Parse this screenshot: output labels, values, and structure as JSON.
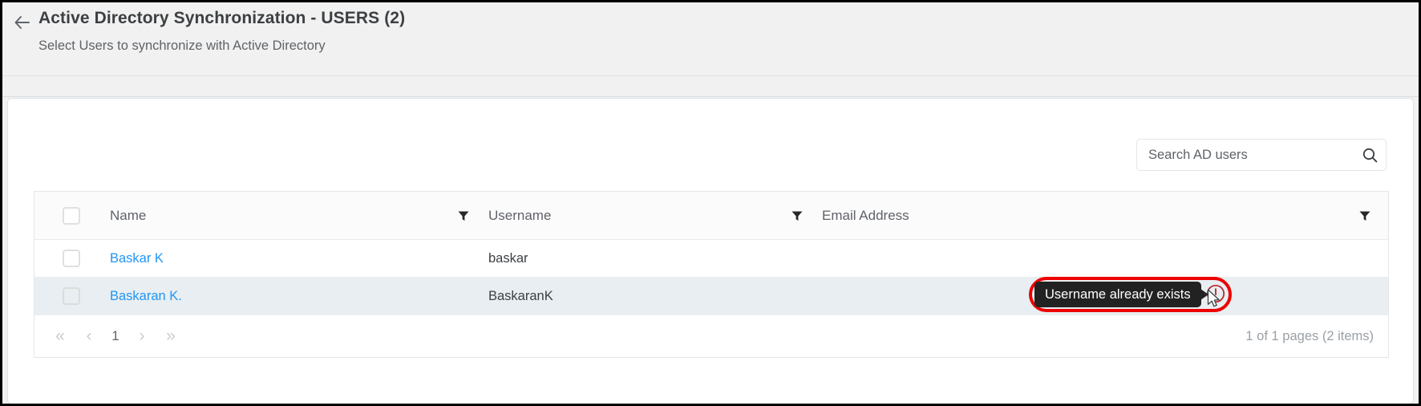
{
  "header": {
    "back_icon": "back-arrow-icon",
    "title": "Active Directory Synchronization - USERS (2)",
    "subtitle": "Select Users to synchronize with Active Directory"
  },
  "search": {
    "placeholder": "Search AD users",
    "value": "",
    "icon": "search-icon"
  },
  "table": {
    "select_all_checkbox": false,
    "columns": [
      {
        "label": "Name",
        "filter_icon": "filter-funnel-icon"
      },
      {
        "label": "Username",
        "filter_icon": "filter-funnel-icon"
      },
      {
        "label": "Email Address",
        "filter_icon": "filter-funnel-icon"
      }
    ],
    "rows": [
      {
        "checked": false,
        "name": "Baskar K",
        "username": "baskar",
        "email": "",
        "highlighted": false
      },
      {
        "checked": false,
        "name": "Baskaran K.",
        "username": "BaskaranK",
        "email": "",
        "highlighted": true
      }
    ]
  },
  "pagination": {
    "first_label": "«",
    "prev_label": "‹",
    "current_page": "1",
    "next_label": "›",
    "last_label": "»",
    "status": "1 of 1 pages (2 items)"
  },
  "tooltip": {
    "text": "Username already exists",
    "warning_icon": "warning-circle-icon",
    "cursor_icon": "mouse-pointer-icon"
  },
  "colors": {
    "link": "#2196f3",
    "annotation": "#ee0000",
    "tooltip_bg": "#222222",
    "row_highlight": "#e8eef1",
    "page_bg": "#f1f1f1"
  }
}
